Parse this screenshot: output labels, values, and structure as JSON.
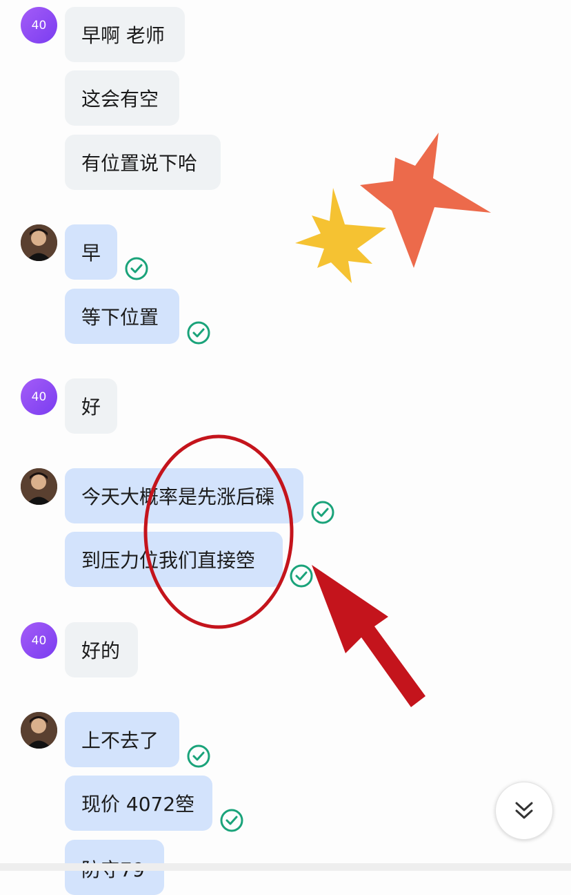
{
  "contact": {
    "avatar_label": "40"
  },
  "messages": [
    {
      "side": "in",
      "text": "早啊 老师"
    },
    {
      "side": "in",
      "text": "这会有空"
    },
    {
      "side": "in",
      "text": "有位置说下哈"
    },
    {
      "side": "out",
      "text": "早",
      "status": "read"
    },
    {
      "side": "out",
      "text": "等下位置",
      "status": "read"
    },
    {
      "side": "in",
      "text": "好"
    },
    {
      "side": "out",
      "text": "今天大概率是先涨后磲",
      "status": "read"
    },
    {
      "side": "out",
      "text": "到压力位我们直接箜",
      "status": "read"
    },
    {
      "side": "in",
      "text": "好的"
    },
    {
      "side": "out",
      "text": "上不去了",
      "status": "read"
    },
    {
      "side": "out",
      "text": "现价 4072箜",
      "status": "read"
    },
    {
      "side": "out",
      "text": "防守79",
      "status": ""
    }
  ],
  "colors": {
    "incoming_bubble": "#eff2f4",
    "outgoing_bubble": "#d3e3fc",
    "read_check": "#1aa37a",
    "avatar_purple": "#8b4cf2",
    "annotation_red": "#c4141c"
  },
  "icons": {
    "scroll_down": "double-chevron-down-icon",
    "read_status": "check-circle-icon"
  }
}
